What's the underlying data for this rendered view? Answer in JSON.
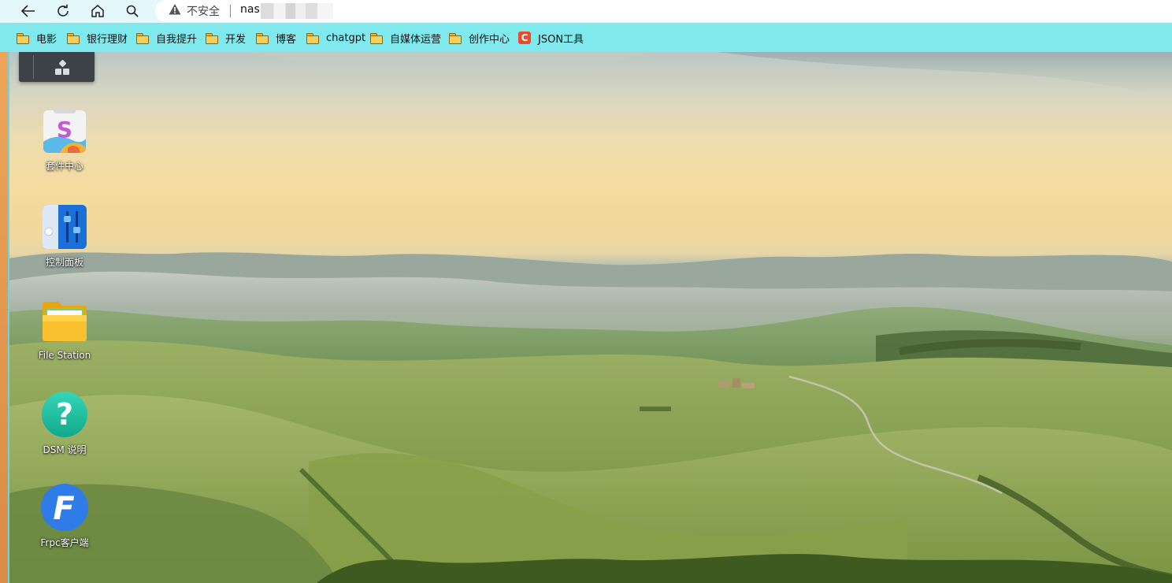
{
  "browser": {
    "nav": {
      "back_icon": "arrow-left-icon",
      "reload_icon": "reload-icon",
      "home_icon": "home-icon",
      "search_icon": "search-icon"
    },
    "address": {
      "security_label": "不安全",
      "url": "nas"
    },
    "bookmarks": [
      {
        "label": "电影",
        "icon": "folder-icon"
      },
      {
        "label": "银行理财",
        "icon": "folder-icon"
      },
      {
        "label": "自我提升",
        "icon": "folder-icon"
      },
      {
        "label": "开发",
        "icon": "folder-icon"
      },
      {
        "label": "博客",
        "icon": "folder-icon"
      },
      {
        "label": "chatgpt",
        "icon": "folder-icon"
      },
      {
        "label": "自媒体运营",
        "icon": "folder-icon"
      },
      {
        "label": "创作中心",
        "icon": "folder-icon"
      },
      {
        "label": "JSON工具",
        "icon": "c-logo-icon",
        "icon_text": "C"
      }
    ]
  },
  "desktop": {
    "launcher": {
      "icon": "main-menu-grid-icon"
    },
    "apps": [
      {
        "label": "套件中心",
        "icon": "package-center-icon",
        "glyph": "S"
      },
      {
        "label": "控制面板",
        "icon": "control-panel-icon"
      },
      {
        "label": "File Station",
        "icon": "file-station-folder-icon"
      },
      {
        "label": "DSM 说明",
        "icon": "help-question-icon",
        "glyph": "?"
      },
      {
        "label": "Frpc客户端",
        "icon": "frpc-icon",
        "glyph": "F"
      }
    ]
  },
  "colors": {
    "bookmark_bar": "#7fe9ee",
    "nav_bar": "#e4f7fb",
    "launcher": "#3d4246",
    "help_icon": "#1fc2a4",
    "frpc_icon": "#2f7ce8"
  }
}
